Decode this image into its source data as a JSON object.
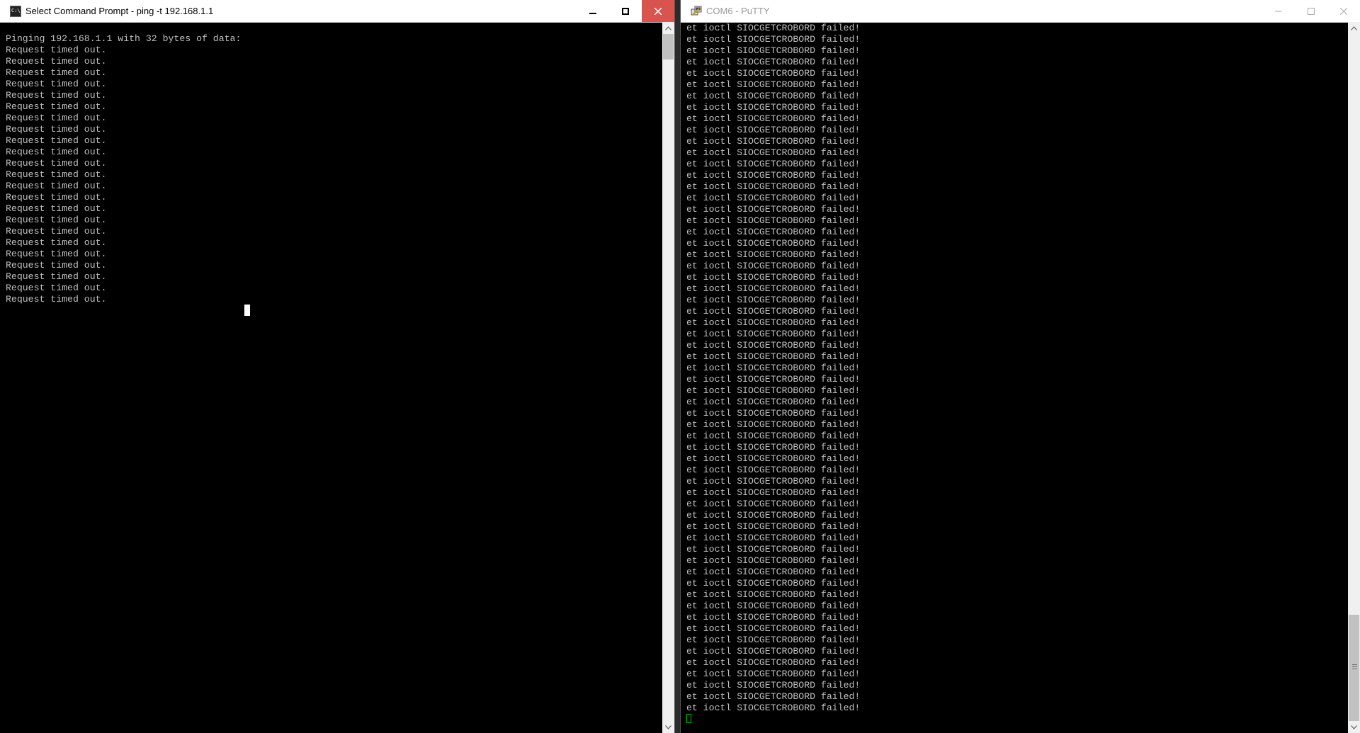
{
  "cmd_window": {
    "title": "Select Command Prompt - ping  -t 192.168.1.1",
    "header_line": "Pinging 192.168.1.1 with 32 bytes of data:",
    "repeated_line": "Request timed out.",
    "repeat_count": 23
  },
  "putty_window": {
    "title": "COM6 - PuTTY",
    "repeated_line": "et ioctl SIOCGETCROBORD failed!",
    "repeat_count": 61,
    "cursor_color": "#00c000"
  },
  "icons": {
    "cmd_app": "command-prompt-icon",
    "putty_app": "putty-icon",
    "minimize": "minimize-icon",
    "maximize": "maximize-icon",
    "close": "close-icon"
  },
  "colors": {
    "close_button": "#d9534f",
    "terminal_text": "#c0c0c0",
    "terminal_bg": "#000000"
  }
}
